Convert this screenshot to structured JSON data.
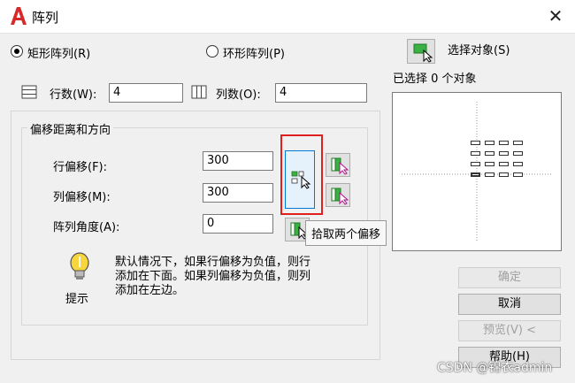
{
  "window": {
    "title": "阵列",
    "close_glyph": "✕"
  },
  "mode": {
    "rect_label": "矩形阵列(R)",
    "polar_label": "环形阵列(P)",
    "selected": "rect"
  },
  "select": {
    "button_label": "选择对象(S)",
    "status": "已选择 0 个对象"
  },
  "rows": {
    "label": "行数(W):",
    "value": "4"
  },
  "cols": {
    "label": "列数(O):",
    "value": "4"
  },
  "offset_group": {
    "title": "偏移距离和方向",
    "row_offset_label": "行偏移(F):",
    "row_offset_value": "300",
    "col_offset_label": "列偏移(M):",
    "col_offset_value": "300",
    "angle_label": "阵列角度(A):",
    "angle_value": "0",
    "tooltip": "拾取两个偏移"
  },
  "hint": {
    "text_line1": "默认情况下，如果行偏移为负值，则行",
    "text_line2": "添加在下面。如果列偏移为负值，则列",
    "text_line3": "添加在左边。",
    "label": "提示"
  },
  "buttons": {
    "ok": "确定",
    "cancel": "取消",
    "preview": "预览(V) <",
    "help": "帮助(H)"
  },
  "watermark": "CSDN @锦衣admin",
  "colors": {
    "accent": "#e02020",
    "selection_blue": "#0078d7"
  }
}
